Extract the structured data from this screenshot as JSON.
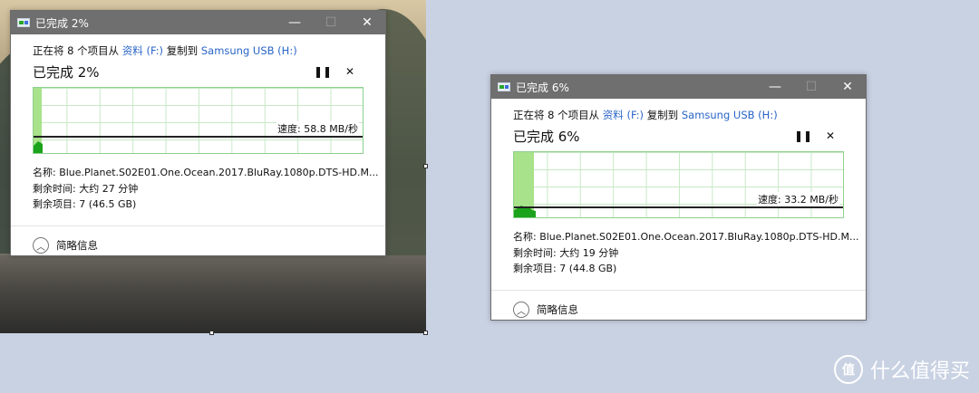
{
  "windows": [
    {
      "title": "已完成 2%",
      "copy_prefix": "正在将 8 个项目从",
      "source": "资料 (F:)",
      "copy_mid": "复制到",
      "destination": "Samsung USB (H:)",
      "status": "已完成 2%",
      "progress_percent": 2,
      "speed": "速度: 58.8 MB/秒",
      "name": "名称:  Blue.Planet.S02E01.One.Ocean.2017.BluRay.1080p.DTS-HD.M...",
      "time_remaining": "剩余时间:  大约 27 分钟",
      "items_remaining": "剩余项目:  7 (46.5 GB)",
      "less_details": "简略信息"
    },
    {
      "title": "已完成 6%",
      "copy_prefix": "正在将 8 个项目从",
      "source": "资料 (F:)",
      "copy_mid": "复制到",
      "destination": "Samsung USB (H:)",
      "status": "已完成 6%",
      "progress_percent": 6,
      "speed": "速度: 33.2 MB/秒",
      "name": "名称:  Blue.Planet.S02E01.One.Ocean.2017.BluRay.1080p.DTS-HD.M...",
      "time_remaining": "剩余时间:  大约 19 分钟",
      "items_remaining": "剩余项目:  7 (44.8 GB)",
      "less_details": "简略信息"
    }
  ],
  "window_controls": {
    "minimize": "—",
    "maximize": "☐",
    "close": "✕",
    "pause": "❚❚",
    "stop": "✕",
    "chevron_up": "︿"
  },
  "watermark": {
    "text": "什么值得买",
    "logo": "值"
  },
  "colors": {
    "titlebar": "#6f6f6f",
    "link": "#2965c7",
    "progress_fill": "#a8e28a",
    "graph_grid": "#c6e9c6"
  },
  "icons": [
    "app-copy-icon",
    "minimize-icon",
    "maximize-icon",
    "close-icon",
    "pause-icon",
    "stop-icon",
    "chevron-up-icon"
  ]
}
